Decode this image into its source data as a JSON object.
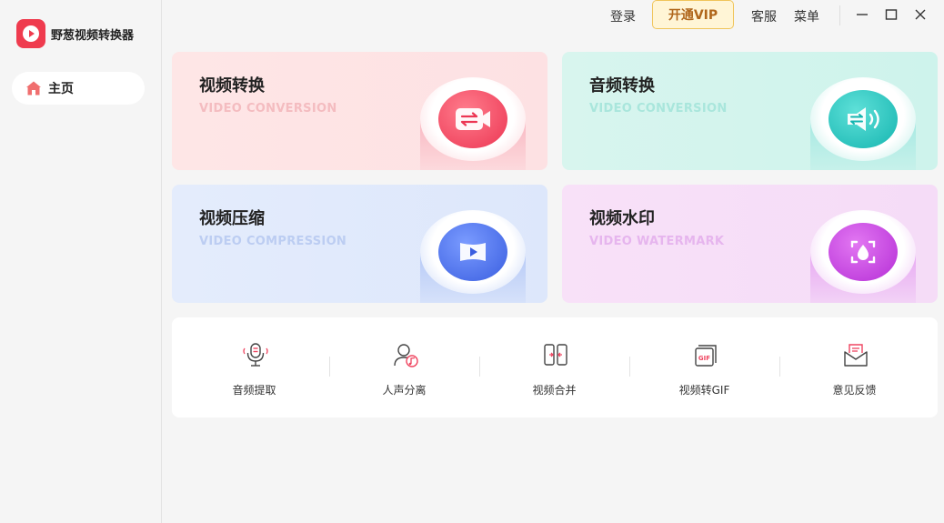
{
  "app": {
    "name": "野葱视频转换器"
  },
  "sidebar": {
    "items": [
      {
        "label": "主页"
      }
    ]
  },
  "topbar": {
    "login": "登录",
    "vip": "开通VIP",
    "service": "客服",
    "menu": "菜单"
  },
  "cards": [
    {
      "title": "视频转换",
      "subtitle": "VIDEO CONVERSION",
      "icon": "video-convert-icon",
      "accent": "#ef4560"
    },
    {
      "title": "音频转换",
      "subtitle": "VIDEO CONVERSION",
      "icon": "audio-convert-icon",
      "accent": "#22c7bf"
    },
    {
      "title": "视频压缩",
      "subtitle": "VIDEO COMPRESSION",
      "icon": "video-compress-icon",
      "accent": "#4169e8"
    },
    {
      "title": "视频水印",
      "subtitle": "VIDEO WATERMARK",
      "icon": "video-watermark-icon",
      "accent": "#c43ee0"
    }
  ],
  "tools": [
    {
      "label": "音频提取",
      "icon": "microphone-icon"
    },
    {
      "label": "人声分离",
      "icon": "voice-separate-icon"
    },
    {
      "label": "视频合并",
      "icon": "video-merge-icon"
    },
    {
      "label": "视频转GIF",
      "icon": "gif-icon"
    },
    {
      "label": "意见反馈",
      "icon": "feedback-mail-icon"
    }
  ],
  "colors": {
    "brand": "#ef3b4e",
    "vip_bg": "#fff5d6",
    "vip_text": "#b0661b"
  }
}
